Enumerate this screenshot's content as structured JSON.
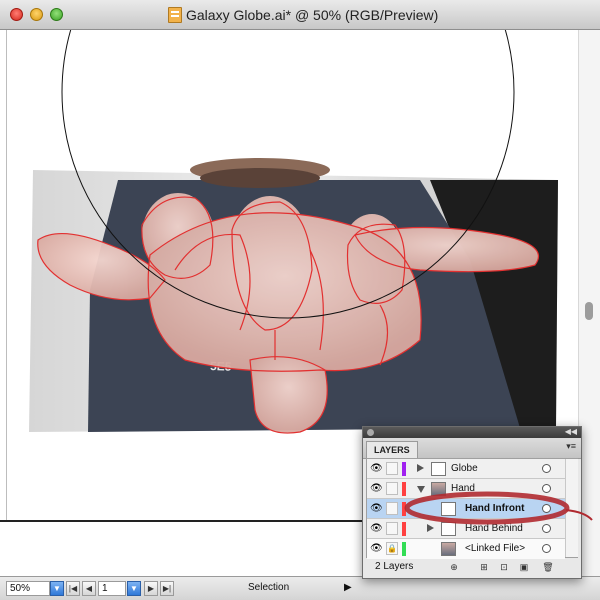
{
  "window": {
    "title": "Galaxy Globe.ai* @ 50% (RGB/Preview)"
  },
  "status_bar": {
    "zoom": "50%",
    "page": "1",
    "tool": "Selection"
  },
  "layers_panel": {
    "tab_label": "LAYERS",
    "footer_count": "2 Layers",
    "rows": [
      {
        "label": "Globe",
        "color": "#a020f0",
        "expanded": false,
        "selected": false
      },
      {
        "label": "Hand",
        "color": "#ff4040",
        "expanded": true,
        "selected": false
      },
      {
        "label": "Hand Infront",
        "color": "#ff4040",
        "expanded": false,
        "selected": true
      },
      {
        "label": "Hand Behind",
        "color": "#ff4040",
        "expanded": false,
        "selected": false
      },
      {
        "label": "<Linked File>",
        "color": "#33dd55",
        "expanded": false,
        "selected": false
      }
    ]
  },
  "icons": {
    "eye": "eye-icon",
    "lock": "lock-icon",
    "new-sublayer": "new-sublayer-icon",
    "new-layer": "new-layer-icon",
    "trash": "trash-icon"
  }
}
